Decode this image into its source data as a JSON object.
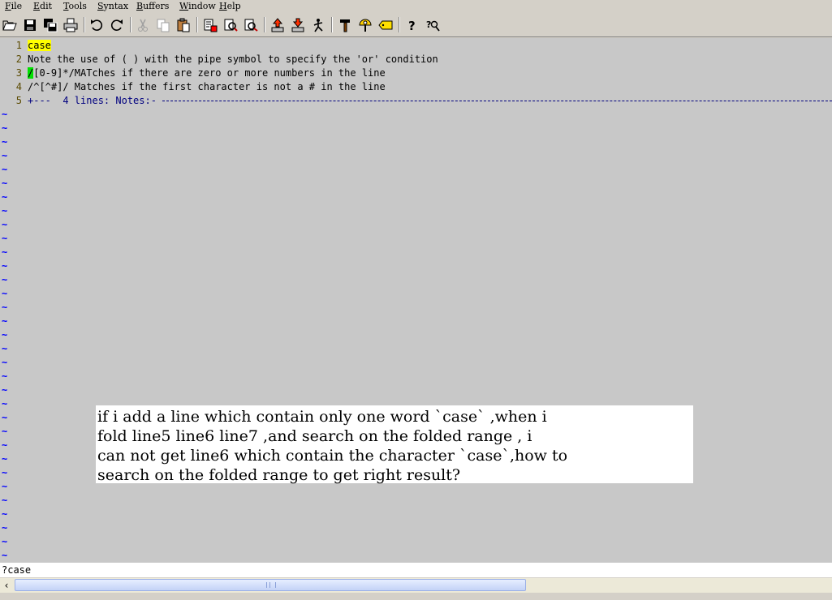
{
  "menu": [
    "File",
    "Edit",
    "Tools",
    "Syntax",
    "Buffers",
    "Window",
    "Help"
  ],
  "toolbar": {
    "buttons": [
      "open-icon",
      "save-icon",
      "save-all-icon",
      "print-icon",
      "undo-icon",
      "redo-icon",
      "cut-icon",
      "copy-icon",
      "paste-icon",
      "replace-icon",
      "find-next-icon",
      "find-prev-icon",
      "load-session-icon",
      "save-session-icon",
      "run-script-icon",
      "make-icon",
      "ctags-icon",
      "jump-tag-icon",
      "help-icon",
      "find-help-icon"
    ]
  },
  "editor": {
    "lines": [
      {
        "num": "1",
        "text": "case"
      },
      {
        "num": "2",
        "text": "Note the use of ( ) with the pipe symbol to specify the 'or' condition"
      },
      {
        "num": "3",
        "cursor": "/",
        "text": "[0-9]*/MATches if there are zero or more numbers in the line"
      },
      {
        "num": "4",
        "text": "/^[^#]/ Matches if the first character is not a # in the line"
      },
      {
        "num": "5",
        "text": "+---  4 lines: Notes:-"
      }
    ],
    "tilde": "~"
  },
  "note": {
    "lines": [
      "if i add a line which contain only one word `case` ,when i",
      "fold line5 line6 line7 ,and search on the folded range , i",
      "can not get line6 which contain the character `case`,how to",
      "search on the folded range to get right result?"
    ]
  },
  "cmdline": "?case",
  "scroll": {
    "left_arrow": "‹"
  }
}
